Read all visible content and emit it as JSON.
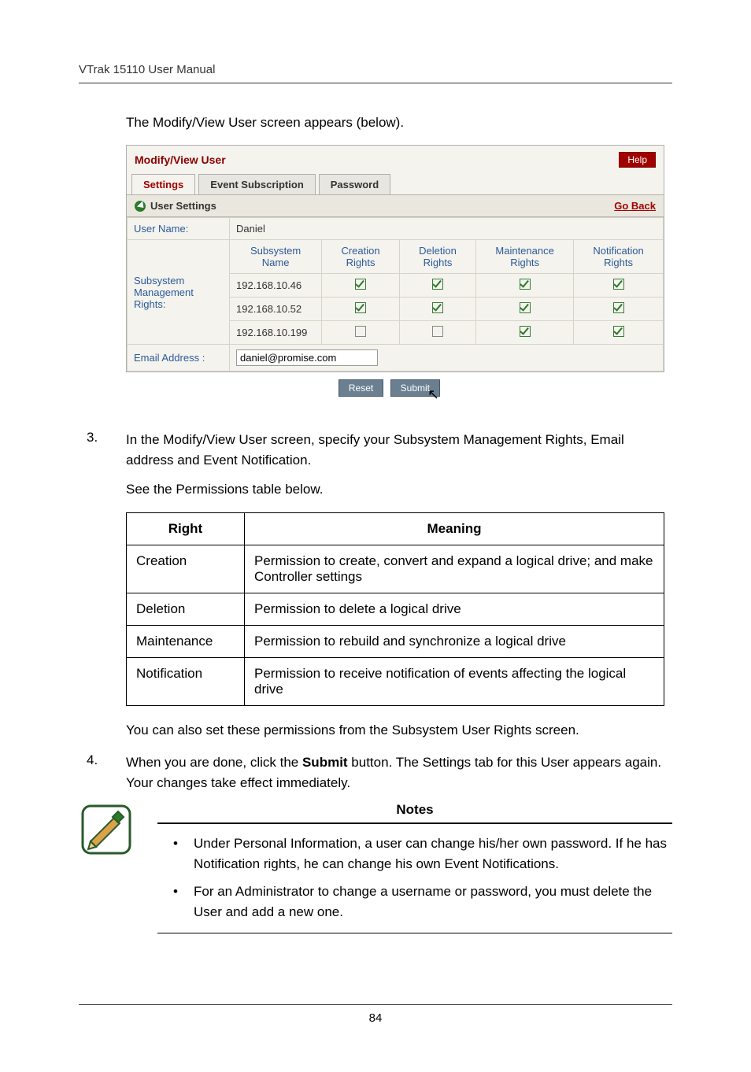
{
  "header": {
    "title": "VTrak 15110 User Manual"
  },
  "intro": "The Modify/View User screen appears (below).",
  "panel": {
    "title": "Modify/View User",
    "help": "Help",
    "tabs": {
      "settings": "Settings",
      "event": "Event Subscription",
      "password": "Password"
    },
    "section": {
      "label": "User Settings",
      "goback": "Go Back"
    },
    "fields": {
      "username_label": "User Name:",
      "username_value": "Daniel",
      "rights_label": "Subsystem Management Rights:",
      "email_label": "Email Address :",
      "email_value": "daniel@promise.com"
    },
    "cols": {
      "subsystem": "Subsystem Name",
      "creation": "Creation Rights",
      "deletion": "Deletion Rights",
      "maintenance": "Maintenance Rights",
      "notification": "Notification Rights"
    },
    "rows": [
      {
        "name": "192.168.10.46",
        "creation": true,
        "deletion": true,
        "maintenance": true,
        "notification": true
      },
      {
        "name": "192.168.10.52",
        "creation": true,
        "deletion": true,
        "maintenance": true,
        "notification": true
      },
      {
        "name": "192.168.10.199",
        "creation": false,
        "deletion": false,
        "maintenance": true,
        "notification": true
      }
    ],
    "buttons": {
      "reset": "Reset",
      "submit": "Submit"
    }
  },
  "steps": {
    "s3_num": "3.",
    "s3_text": "In the Modify/View User screen, specify your Subsystem Management Rights, Email address and Event Notification.",
    "s3_sub": "See the Permissions table below.",
    "s4_num": "4.",
    "s4_text_pre": "When you are done, click the ",
    "s4_bold": "Submit",
    "s4_text_post": " button. The Settings tab for this User appears again. Your changes take effect immediately."
  },
  "after_table": "You can also set these permissions from the Subsystem User Rights screen.",
  "perm": {
    "h_right": "Right",
    "h_meaning": "Meaning",
    "rows": [
      {
        "r": "Creation",
        "m": "Permission to create, convert and expand a logical drive; and make Controller settings"
      },
      {
        "r": "Deletion",
        "m": "Permission to delete a logical drive"
      },
      {
        "r": "Maintenance",
        "m": "Permission to rebuild and synchronize a logical drive"
      },
      {
        "r": "Notification",
        "m": "Permission to receive notification of events affecting the logical drive"
      }
    ]
  },
  "notes": {
    "title": "Notes",
    "items": [
      "Under Personal Information, a user can change his/her own password. If he has Notification rights, he can change his own Event Notifications.",
      "For an Administrator to change a username or password, you must delete the User and add a new one."
    ]
  },
  "footer": {
    "page": "84"
  }
}
